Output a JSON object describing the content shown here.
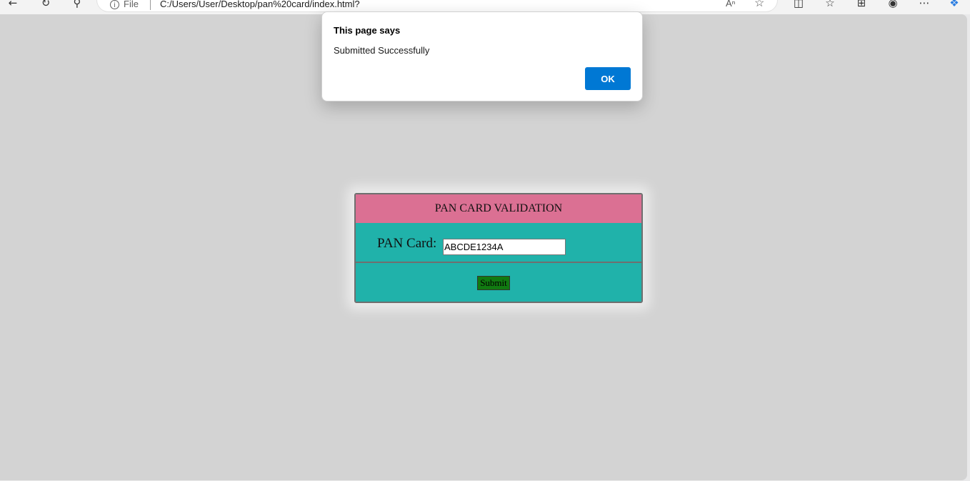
{
  "browser": {
    "site_info_label": "File",
    "url": "C:/Users/User/Desktop/pan%20card/index.html?",
    "icons": [
      "back-icon",
      "refresh-icon",
      "search-icon",
      "info-icon",
      "read-aloud-icon",
      "favorite-icon",
      "split-screen-icon",
      "favorites-list-icon",
      "collections-icon",
      "extensions-icon",
      "more-icon",
      "copilot-icon"
    ]
  },
  "dialog": {
    "title": "This page says",
    "message": "Submitted Successfully",
    "ok_label": "OK"
  },
  "form": {
    "header": "PAN CARD VALIDATION",
    "pan_label": "PAN Card:",
    "pan_value": "ABCDE1234A",
    "submit_label": "Submit"
  },
  "colors": {
    "page_background": "#d3d3d3",
    "header_background": "#db7093",
    "form_background": "#20b2aa",
    "submit_background": "#117a11",
    "ok_button": "#0078d4"
  }
}
